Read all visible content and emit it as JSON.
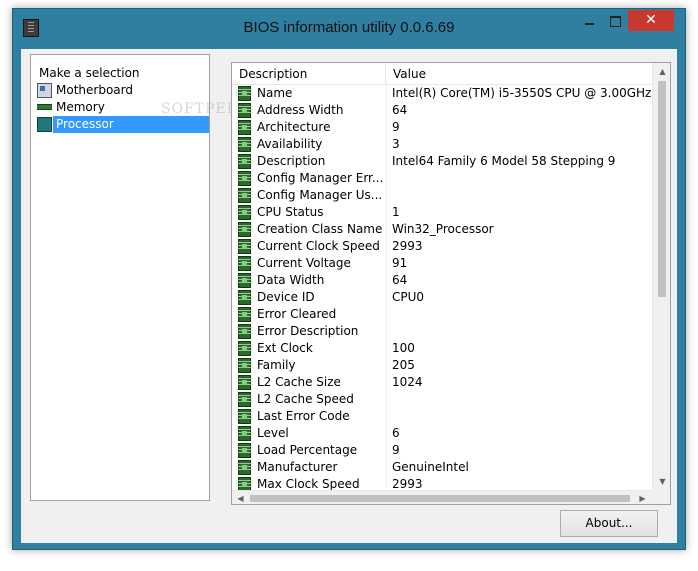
{
  "window": {
    "title": "BIOS information utility 0.0.6.69"
  },
  "left_panel": {
    "header": "Make a selection",
    "items": [
      {
        "label": "Motherboard",
        "icon": "motherboard-icon",
        "selected": false
      },
      {
        "label": "Memory",
        "icon": "memory-icon",
        "selected": false
      },
      {
        "label": "Processor",
        "icon": "processor-icon",
        "selected": true
      }
    ]
  },
  "table": {
    "columns": [
      "Description",
      "Value"
    ],
    "rows": [
      {
        "desc": "Name",
        "value": "Intel(R) Core(TM) i5-3550S CPU @ 3.00GHz"
      },
      {
        "desc": "Address Width",
        "value": "64"
      },
      {
        "desc": "Architecture",
        "value": "9"
      },
      {
        "desc": "Availability",
        "value": "3"
      },
      {
        "desc": "Description",
        "value": "Intel64 Family 6 Model 58 Stepping 9"
      },
      {
        "desc": "Config Manager Err...",
        "value": ""
      },
      {
        "desc": "Config Manager Us...",
        "value": ""
      },
      {
        "desc": "CPU Status",
        "value": "1"
      },
      {
        "desc": "Creation Class Name",
        "value": "Win32_Processor"
      },
      {
        "desc": "Current Clock Speed",
        "value": "2993"
      },
      {
        "desc": "Current Voltage",
        "value": "91"
      },
      {
        "desc": "Data Width",
        "value": "64"
      },
      {
        "desc": "Device ID",
        "value": "CPU0"
      },
      {
        "desc": "Error Cleared",
        "value": ""
      },
      {
        "desc": "Error Description",
        "value": ""
      },
      {
        "desc": "Ext Clock",
        "value": "100"
      },
      {
        "desc": "Family",
        "value": "205"
      },
      {
        "desc": "L2 Cache Size",
        "value": "1024"
      },
      {
        "desc": "L2 Cache Speed",
        "value": ""
      },
      {
        "desc": "Last Error Code",
        "value": ""
      },
      {
        "desc": "Level",
        "value": "6"
      },
      {
        "desc": "Load Percentage",
        "value": "9"
      },
      {
        "desc": "Manufacturer",
        "value": "GenuineIntel"
      },
      {
        "desc": "Max Clock Speed",
        "value": "2993"
      }
    ]
  },
  "buttons": {
    "about": "About..."
  },
  "watermark": "SOFTPEDIA",
  "colors": {
    "selection": "#3399ff",
    "close_button": "#c7392f",
    "frame": "#2f7fa0"
  }
}
